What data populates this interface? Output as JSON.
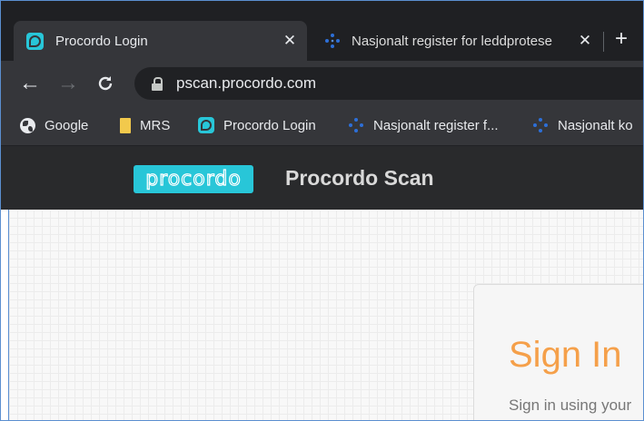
{
  "browser": {
    "tabs": [
      {
        "title": "Procordo Login",
        "active": true,
        "favicon": "procordo-favicon"
      },
      {
        "title": "Nasjonalt register for leddprotese",
        "active": false,
        "favicon": "nrl-favicon"
      }
    ],
    "close_glyph": "✕",
    "new_tab_glyph": "+",
    "nav": {
      "back": "←",
      "forward": "→",
      "reload": "↻"
    },
    "url": "pscan.procordo.com",
    "bookmarks": [
      {
        "label": "Google",
        "icon": "globe-icon"
      },
      {
        "label": "MRS",
        "icon": "bookmark-icon"
      },
      {
        "label": "Procordo Login",
        "icon": "procordo-favicon"
      },
      {
        "label": "Nasjonalt register f...",
        "icon": "nrl-favicon"
      },
      {
        "label": "Nasjonalt ko",
        "icon": "nrl-favicon"
      }
    ]
  },
  "site": {
    "logo_text": "procordo",
    "app_name": "Procordo Scan",
    "brand_color": "#28c6d8"
  },
  "signin": {
    "title": "Sign In",
    "subtitle": "Sign in using your",
    "title_color": "#f5a04a"
  }
}
